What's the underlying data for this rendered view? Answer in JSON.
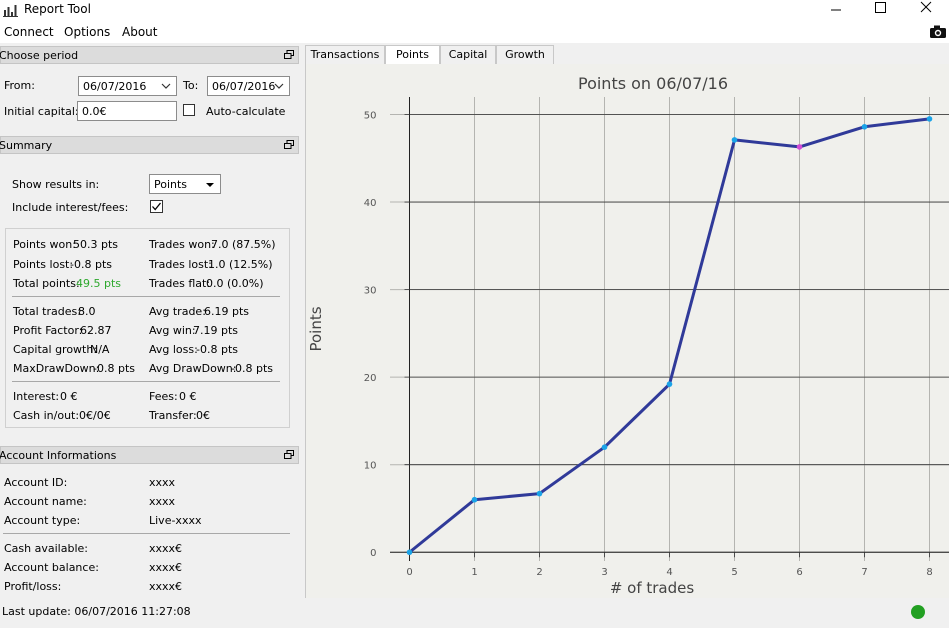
{
  "window": {
    "title": "Report Tool",
    "controls": [
      "minimize",
      "maximize",
      "close"
    ]
  },
  "menu": {
    "items": [
      "Connect",
      "Options",
      "About"
    ]
  },
  "choose_period": {
    "title": "Choose period",
    "from_label": "From:",
    "from_value": "06/07/2016",
    "to_label": "To:",
    "to_value": "06/07/2016",
    "capital_label": "Initial capital:",
    "capital_value": "0.0€",
    "auto_label": "Auto-calculate",
    "auto_checked": false
  },
  "summary": {
    "title": "Summary",
    "show_results_label": "Show results in:",
    "show_results_value": "Points",
    "include_label": "Include interest/fees:",
    "include_checked": true,
    "points_won_label": "Points won:",
    "points_won": "50.3 pts",
    "trades_won_label": "Trades won:",
    "trades_won": "7.0 (87.5%)",
    "points_lost_label": "Points lost:",
    "points_lost": "-0.8 pts",
    "trades_lost_label": "Trades lost:",
    "trades_lost": "1.0 (12.5%)",
    "total_points_label": "Total points:",
    "total_points": "49.5 pts",
    "trades_flat_label": "Trades flat:",
    "trades_flat": "0.0 (0.0%)",
    "total_trades_label": "Total trades:",
    "total_trades": "8.0",
    "avg_trade_label": "Avg trade:",
    "avg_trade": "6.19 pts",
    "profit_factor_label": "Profit Factor:",
    "profit_factor": "62.87",
    "avg_win_label": "Avg win:",
    "avg_win": "7.19 pts",
    "capital_growth_label": "Capital growth:",
    "capital_growth": "N/A",
    "avg_loss_label": "Avg loss:",
    "avg_loss": "-0.8 pts",
    "max_dd_label": "MaxDrawDown:",
    "max_dd": "-0.8 pts",
    "avg_dd_label": "Avg DrawDown:",
    "avg_dd": "-0.8 pts",
    "interest_label": "Interest:",
    "interest": "0 €",
    "fees_label": "Fees:",
    "fees": "0 €",
    "cash_label": "Cash in/out:",
    "cash": "0€/0€",
    "transfer_label": "Transfer:",
    "transfer": "0€",
    "positive_color": "#2ea82e"
  },
  "account": {
    "title": "Account Informations",
    "rows": [
      {
        "label": "Account ID:",
        "value": "xxxx"
      },
      {
        "label": "Account name:",
        "value": "xxxx"
      },
      {
        "label": "Account type:",
        "value": "Live-xxxx"
      },
      {
        "label": "Cash available:",
        "value": "xxxx€"
      },
      {
        "label": "Account balance:",
        "value": "xxxx€"
      },
      {
        "label": "Profit/loss:",
        "value": "xxxx€"
      }
    ]
  },
  "tabs": [
    "Transactions",
    "Points",
    "Capital",
    "Growth"
  ],
  "active_tab": "Points",
  "chart_data": {
    "type": "line",
    "title": "Points on 06/07/16",
    "xlabel": "# of trades",
    "ylabel": "Points",
    "x": [
      0,
      1,
      2,
      3,
      4,
      5,
      6,
      7,
      8
    ],
    "y": [
      0,
      6.0,
      6.7,
      12.0,
      19.2,
      47.1,
      46.3,
      48.6,
      49.5
    ],
    "xlim": [
      -0.3,
      8.3
    ],
    "ylim": [
      -1,
      52
    ],
    "xticks": [
      0,
      1,
      2,
      3,
      4,
      5,
      6,
      7,
      8
    ],
    "yticks": [
      0,
      10,
      20,
      30,
      40,
      50
    ],
    "grid": true,
    "line_color": "#303a99",
    "win_point_color": "#1aa3e8",
    "loss_point_color": "#d24ad6",
    "point_types": [
      "win",
      "win",
      "win",
      "win",
      "win",
      "win",
      "loss",
      "win",
      "win"
    ]
  },
  "status": {
    "text": "Last update: 06/07/2016 11:27:08",
    "led_color": "#22a022"
  }
}
